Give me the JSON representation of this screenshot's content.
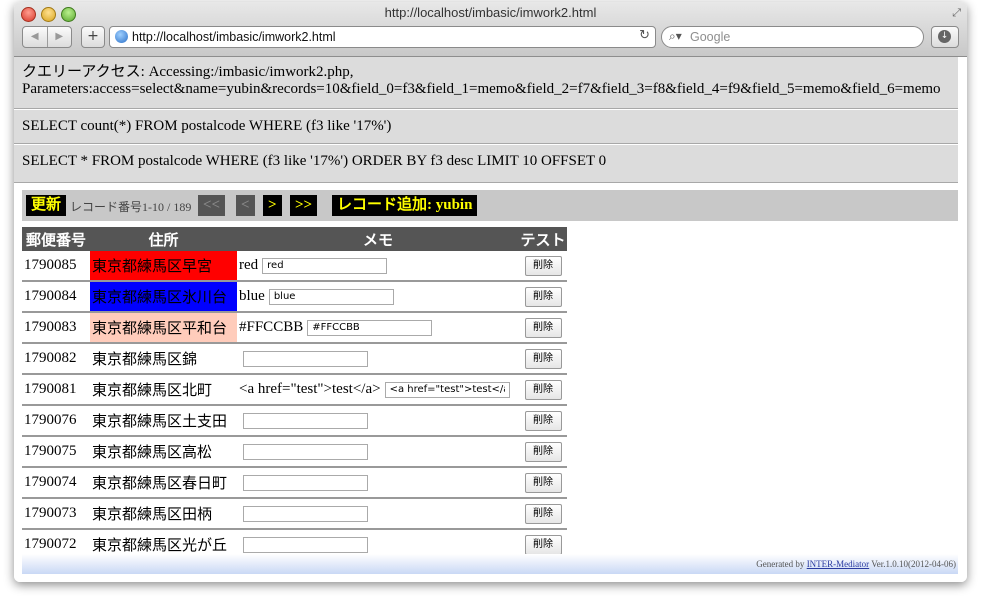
{
  "browser": {
    "title": "http://localhost/imbasic/imwork2.html",
    "url": "http://localhost/imbasic/imwork2.html",
    "search_placeholder": "Google"
  },
  "access": {
    "line1": "クエリーアクセス: Accessing:/imbasic/imwork2.php,",
    "line2": "Parameters:access=select&name=yubin&records=10&field_0=f3&field_1=memo&field_2=f7&field_3=f8&field_4=f9&field_5=memo&field_6=memo"
  },
  "sql": {
    "count_query": "SELECT count(*) FROM postalcode WHERE (f3 like '17%')",
    "select_query": "SELECT * FROM postalcode WHERE (f3 like '17%') ORDER BY f3 desc LIMIT 10 OFFSET 0"
  },
  "navigation": {
    "refresh": "更新",
    "record_info": "レコード番号1-10 / 189",
    "first": "<<",
    "prev": "<",
    "next": ">",
    "last": ">>",
    "add_record": "レコード追加: yubin"
  },
  "table": {
    "headers": [
      "郵便番号",
      "住所",
      "メモ",
      "テスト"
    ],
    "delete_label": "削除",
    "rows": [
      {
        "zip": "1790085",
        "address": "東京都練馬区早宮",
        "memo": "red",
        "memo_input": "red",
        "bg": "#ff0000"
      },
      {
        "zip": "1790084",
        "address": "東京都練馬区氷川台",
        "memo": "blue",
        "memo_input": "blue",
        "bg": "#0000ff"
      },
      {
        "zip": "1790083",
        "address": "東京都練馬区平和台",
        "memo": "#FFCCBB",
        "memo_input": "#FFCCBB",
        "bg": "#FFCCBB"
      },
      {
        "zip": "1790082",
        "address": "東京都練馬区錦",
        "memo": "",
        "memo_input": "",
        "bg": ""
      },
      {
        "zip": "1790081",
        "address": "東京都練馬区北町",
        "memo": "<a href=\"test\">test</a>",
        "memo_input": "<a href=\"test\">test</a>",
        "bg": ""
      },
      {
        "zip": "1790076",
        "address": "東京都練馬区土支田",
        "memo": "",
        "memo_input": "",
        "bg": ""
      },
      {
        "zip": "1790075",
        "address": "東京都練馬区高松",
        "memo": "",
        "memo_input": "",
        "bg": ""
      },
      {
        "zip": "1790074",
        "address": "東京都練馬区春日町",
        "memo": "",
        "memo_input": "",
        "bg": ""
      },
      {
        "zip": "1790073",
        "address": "東京都練馬区田柄",
        "memo": "",
        "memo_input": "",
        "bg": ""
      },
      {
        "zip": "1790072",
        "address": "東京都練馬区光が丘",
        "memo": "",
        "memo_input": "",
        "bg": ""
      }
    ]
  },
  "footer": {
    "prefix": "Generated by ",
    "link": "INTER-Mediator",
    "suffix": " Ver.1.0.10(2012-04-06)"
  }
}
